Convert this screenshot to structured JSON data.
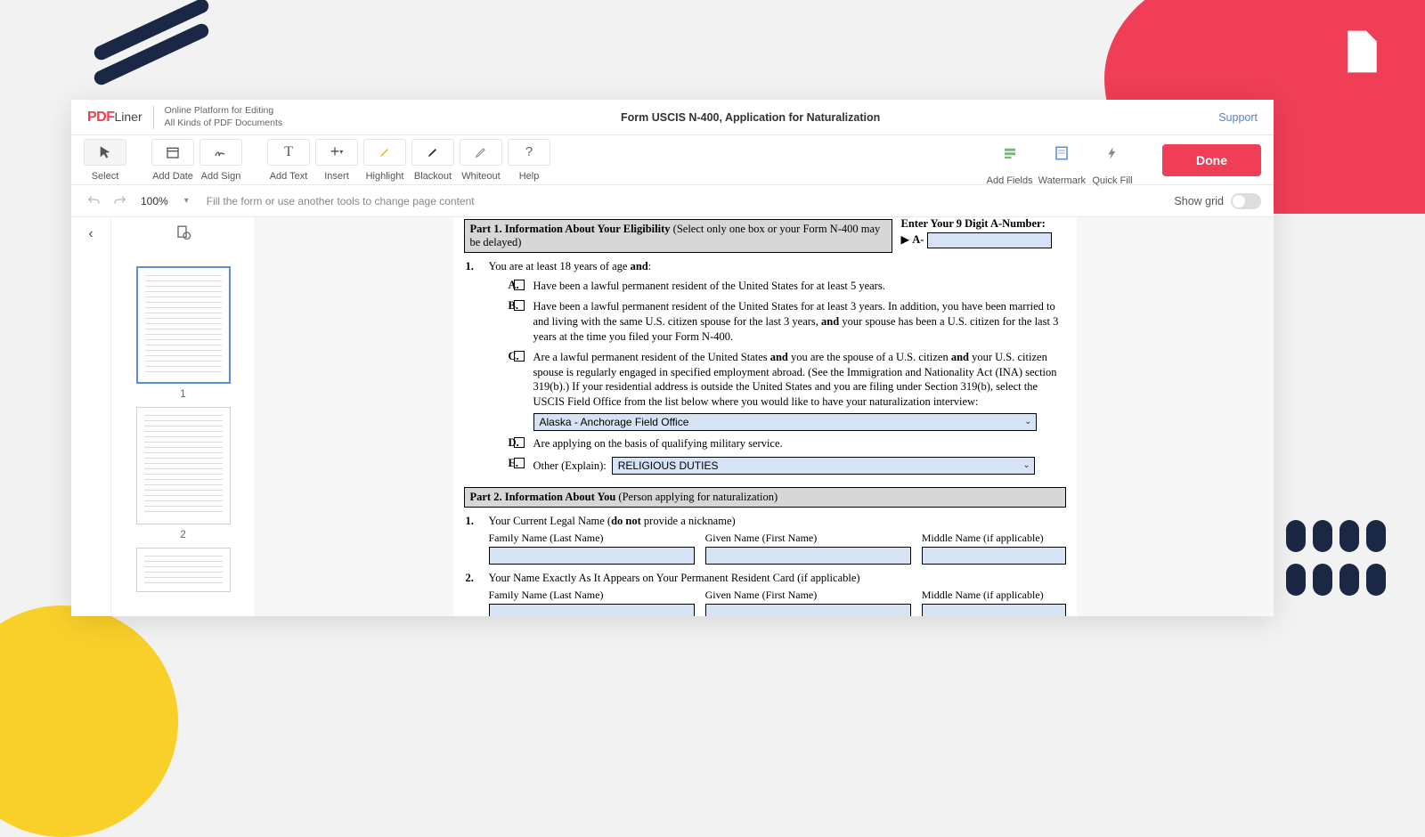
{
  "header": {
    "logo_pdf": "PDF",
    "logo_liner": "Liner",
    "tagline_l1": "Online Platform for Editing",
    "tagline_l2": "All Kinds of PDF Documents",
    "doc_title": "Form USCIS N-400, Application for Naturalization",
    "support": "Support"
  },
  "toolbar": {
    "select": "Select",
    "add_date": "Add Date",
    "add_sign": "Add Sign",
    "add_text": "Add Text",
    "insert": "Insert",
    "highlight": "Highlight",
    "blackout": "Blackout",
    "whiteout": "Whiteout",
    "help": "Help",
    "add_fields": "Add Fields",
    "watermark": "Watermark",
    "quick_fill": "Quick Fill",
    "done": "Done"
  },
  "subbar": {
    "zoom": "100%",
    "hint": "Fill the form or use another tools to change page content",
    "show_grid": "Show grid"
  },
  "thumbs": {
    "p1": "1",
    "p2": "2"
  },
  "form": {
    "part1_label": "Part 1.  Information About Your Eligibility ",
    "part1_paren": "(Select only one box or your Form N-400 may be delayed)",
    "anum_label": "Enter Your 9 Digit A-Number:",
    "anum_prefix": "A-",
    "q1_num": "1.",
    "q1_text_pre": "You are at least 18 years of age ",
    "q1_text_bold": "and",
    "q1_text_post": ":",
    "optA_letter": "A.",
    "optA_text": "Have been a lawful permanent resident of the United States for at least 5 years.",
    "optB_letter": "B.",
    "optB_text_pre": "Have been a lawful permanent resident of the United States for at least 3 years.  In addition, you have been married to and living with the same U.S. citizen spouse for the last 3 years, ",
    "optB_text_bold": "and",
    "optB_text_post": " your spouse has been a U.S. citizen for the last 3 years at the time you filed your Form N-400.",
    "optC_letter": "C.",
    "optC_p1": "Are a lawful permanent resident of the United States ",
    "optC_b1": "and",
    "optC_p2": " you are the spouse of a U.S. citizen ",
    "optC_b2": "and",
    "optC_p3": " your U.S. citizen spouse is regularly engaged in specified employment abroad.  (See the Immigration and Nationality Act (INA) section 319(b).)  If your residential address is outside the United States and you are filing under Section 319(b), select the USCIS Field Office from the list below where you would like to have your naturalization interview:",
    "optC_dropdown": "Alaska - Anchorage Field Office",
    "optD_letter": "D.",
    "optD_text": "Are applying on the basis of qualifying military service.",
    "optE_letter": "E.",
    "optE_label": "Other (Explain):",
    "optE_value": "RELIGIOUS DUTIES",
    "part2_label": "Part 2.  Information About You ",
    "part2_paren": "(Person applying for naturalization)",
    "q2_1_num": "1.",
    "q2_1_pre": "Your Current Legal Name (",
    "q2_1_bold": "do not",
    "q2_1_post": " provide a nickname)",
    "family": "Family Name (Last Name)",
    "given": "Given Name (First Name)",
    "middle": "Middle Name (if applicable)",
    "q2_2_num": "2.",
    "q2_2_text": "Your Name Exactly As It Appears on Your Permanent Resident Card (if applicable)"
  }
}
